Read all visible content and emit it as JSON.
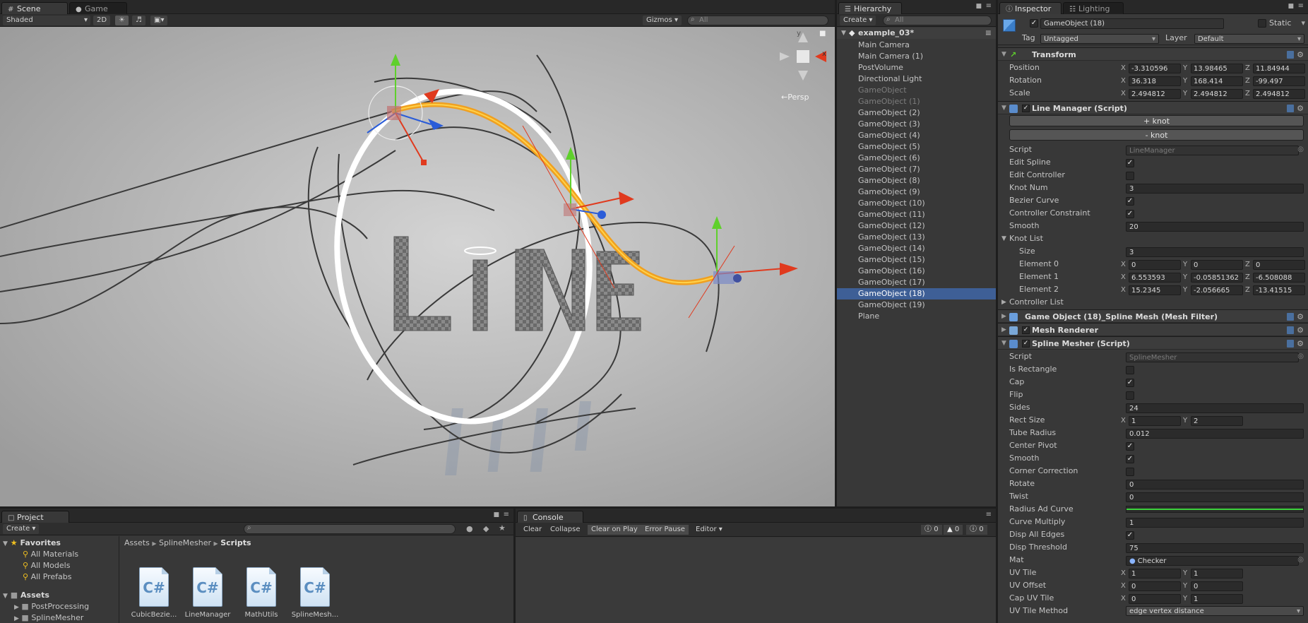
{
  "scene": {
    "tab_scene": "Scene",
    "tab_game": "Game",
    "shading_mode": "Shaded",
    "mode_2d": "2D",
    "gizmos_label": "Gizmos",
    "search_placeholder": "All",
    "persp_label": "Persp",
    "gizmo_axis_y": "y",
    "gizmo_axis_x": "x",
    "scene_text": "LINE"
  },
  "hierarchy": {
    "tab": "Hierarchy",
    "create": "Create",
    "search_placeholder": "All",
    "scene_name": "example_03*",
    "items": [
      {
        "label": "Main Camera",
        "state": "normal"
      },
      {
        "label": "Main Camera (1)",
        "state": "normal"
      },
      {
        "label": "PostVolume",
        "state": "normal"
      },
      {
        "label": "Directional Light",
        "state": "normal"
      },
      {
        "label": "GameObject",
        "state": "dim"
      },
      {
        "label": "GameObject (1)",
        "state": "dim"
      },
      {
        "label": "GameObject (2)",
        "state": "normal"
      },
      {
        "label": "GameObject (3)",
        "state": "normal"
      },
      {
        "label": "GameObject (4)",
        "state": "normal"
      },
      {
        "label": "GameObject (5)",
        "state": "normal"
      },
      {
        "label": "GameObject (6)",
        "state": "normal"
      },
      {
        "label": "GameObject (7)",
        "state": "normal"
      },
      {
        "label": "GameObject (8)",
        "state": "normal"
      },
      {
        "label": "GameObject (9)",
        "state": "normal"
      },
      {
        "label": "GameObject (10)",
        "state": "normal"
      },
      {
        "label": "GameObject (11)",
        "state": "normal"
      },
      {
        "label": "GameObject (12)",
        "state": "normal"
      },
      {
        "label": "GameObject (13)",
        "state": "normal"
      },
      {
        "label": "GameObject (14)",
        "state": "normal"
      },
      {
        "label": "GameObject (15)",
        "state": "normal"
      },
      {
        "label": "GameObject (16)",
        "state": "normal"
      },
      {
        "label": "GameObject (17)",
        "state": "normal"
      },
      {
        "label": "GameObject (18)",
        "state": "selected"
      },
      {
        "label": "GameObject (19)",
        "state": "normal"
      },
      {
        "label": "Plane",
        "state": "normal"
      }
    ]
  },
  "inspector": {
    "tab": "Inspector",
    "tab_lighting": "Lighting",
    "object_name": "GameObject (18)",
    "static_label": "Static",
    "tag_label": "Tag",
    "tag_value": "Untagged",
    "layer_label": "Layer",
    "layer_value": "Default",
    "transform": {
      "title": "Transform",
      "position_label": "Position",
      "position": [
        "-3.310596",
        "13.98465",
        "11.84944"
      ],
      "rotation_label": "Rotation",
      "rotation": [
        "36.318",
        "168.414",
        "-99.497"
      ],
      "scale_label": "Scale",
      "scale": [
        "2.494812",
        "2.494812",
        "2.494812"
      ]
    },
    "axis": [
      "X",
      "Y",
      "Z"
    ],
    "line_manager": {
      "title": "Line Manager (Script)",
      "add_knot": "+ knot",
      "remove_knot": "- knot",
      "script_label": "Script",
      "script_value": "LineManager",
      "edit_spline": "Edit Spline",
      "edit_controller": "Edit Controller",
      "knot_num_label": "Knot Num",
      "knot_num": "3",
      "bezier_curve": "Bezier Curve",
      "controller_constraint": "Controller Constraint",
      "smooth_label": "Smooth",
      "smooth": "20",
      "knot_list": "Knot List",
      "size_label": "Size",
      "size": "3",
      "e0_label": "Element 0",
      "e0": [
        "0",
        "0",
        "0"
      ],
      "e1_label": "Element 1",
      "e1": [
        "6.553593",
        "-0.05851362",
        "-6.508088"
      ],
      "e2_label": "Element 2",
      "e2": [
        "15.2345",
        "-2.056665",
        "-13.41515"
      ],
      "controller_list": "Controller List"
    },
    "mesh_filter": {
      "title": "Game Object (18)_Spline Mesh (Mesh Filter)"
    },
    "mesh_renderer": {
      "title": "Mesh Renderer"
    },
    "spline_mesher": {
      "title": "Spline Mesher (Script)",
      "script_label": "Script",
      "script_value": "SplineMesher",
      "is_rectangle": "Is Rectangle",
      "cap": "Cap",
      "flip": "Flip",
      "sides_label": "Sides",
      "sides": "24",
      "rect_size_label": "Rect Size",
      "rect_size": [
        "1",
        "2"
      ],
      "tube_radius_label": "Tube Radius",
      "tube_radius": "0.012",
      "center_pivot": "Center Pivot",
      "smooth": "Smooth",
      "corner_correction": "Corner Correction",
      "rotate_label": "Rotate",
      "rotate": "0",
      "twist_label": "Twist",
      "twist": "0",
      "radius_ad_curve": "Radius Ad Curve",
      "curve_multiply_label": "Curve Multiply",
      "curve_multiply": "1",
      "disp_all_edges": "Disp All Edges",
      "disp_threshold_label": "Disp Threshold",
      "disp_threshold": "75",
      "mat_label": "Mat",
      "mat": "Checker",
      "uv_tile_label": "UV Tile",
      "uv_tile": [
        "1",
        "1"
      ],
      "uv_offset_label": "UV Offset",
      "uv_offset": [
        "0",
        "0"
      ],
      "cap_uv_tile_label": "Cap UV Tile",
      "cap_uv_tile": [
        "0",
        "1"
      ],
      "uv_tile_method_label": "UV Tile Method",
      "uv_tile_method": "edge vertex distance"
    }
  },
  "project": {
    "tab": "Project",
    "create": "Create",
    "favorites": "Favorites",
    "fav_items": [
      "All Materials",
      "All Models",
      "All Prefabs"
    ],
    "assets": "Assets",
    "asset_folders": [
      "PostProcessing",
      "SplineMesher"
    ],
    "breadcrumb": [
      "Assets",
      "SplineMesher",
      "Scripts"
    ],
    "files": [
      "CubicBezie...",
      "LineManager",
      "MathUtils",
      "SplineMesh..."
    ],
    "file_glyph": "C#"
  },
  "console": {
    "tab": "Console",
    "clear": "Clear",
    "collapse": "Collapse",
    "clear_on_play": "Clear on Play",
    "error_pause": "Error Pause",
    "editor": "Editor",
    "count_log": "0",
    "count_warn": "0",
    "count_err": "0"
  },
  "colors": {
    "accent_selected": "#3e5f96",
    "spline_orange": "#f0a020",
    "gizmo_red": "#e03a1e",
    "gizmo_green": "#5fd02c",
    "gizmo_blue": "#2a5cd8"
  }
}
